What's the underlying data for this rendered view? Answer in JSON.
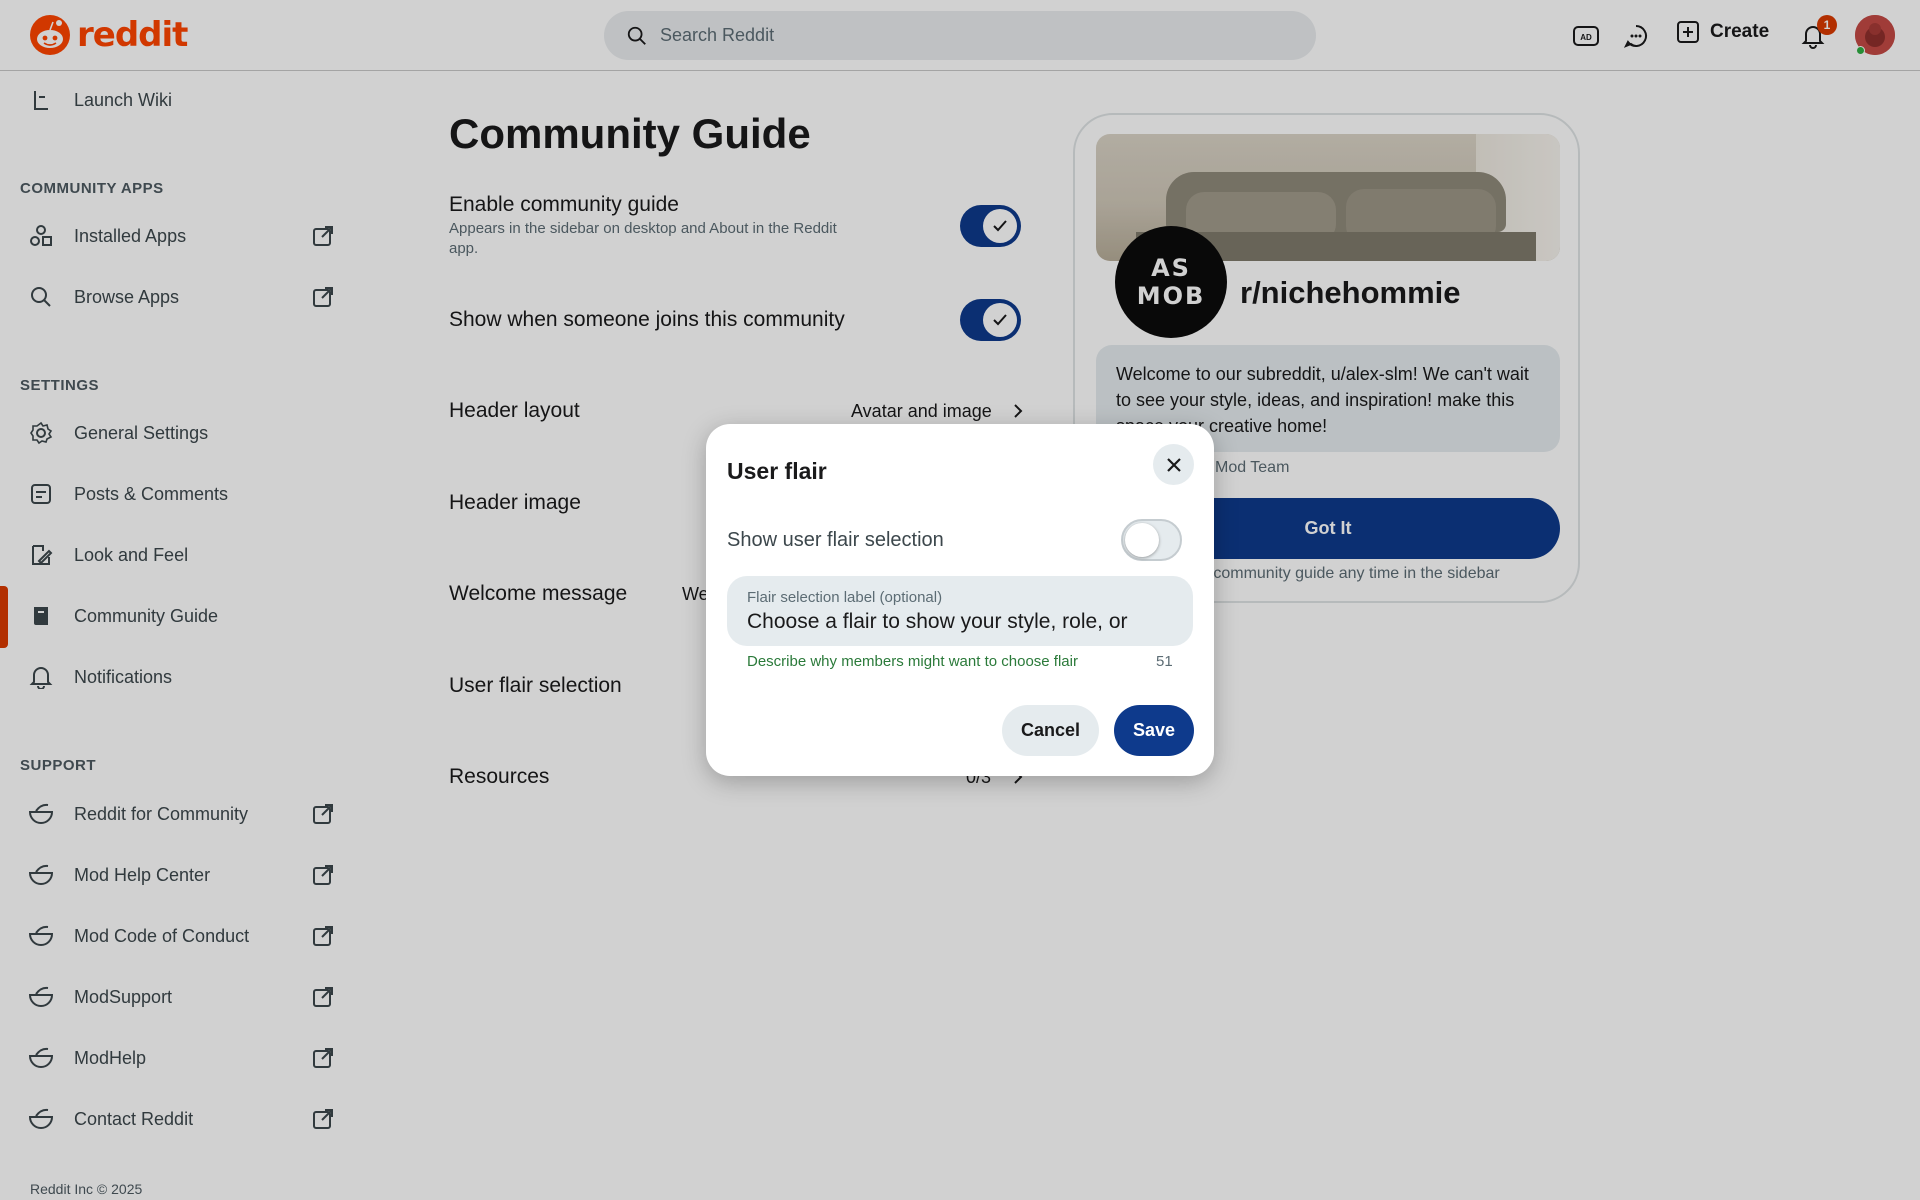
{
  "header": {
    "logo_text": "reddit",
    "search_placeholder": "Search Reddit",
    "create_label": "Create",
    "notification_count": "1",
    "icons": [
      "ad-icon",
      "chat-icon",
      "create-icon",
      "bell-icon"
    ]
  },
  "sidebar": {
    "launch_wiki": "Launch Wiki",
    "apps_heading": "COMMUNITY APPS",
    "apps": [
      {
        "label": "Installed Apps",
        "icon": "apps-icon",
        "external": true
      },
      {
        "label": "Browse Apps",
        "icon": "search-icon",
        "external": true
      }
    ],
    "settings_heading": "SETTINGS",
    "settings": [
      {
        "label": "General Settings",
        "icon": "gear-icon"
      },
      {
        "label": "Posts & Comments",
        "icon": "posts-icon"
      },
      {
        "label": "Look and Feel",
        "icon": "brush-icon"
      },
      {
        "label": "Community Guide",
        "icon": "book-icon",
        "active": true
      },
      {
        "label": "Notifications",
        "icon": "bell-icon"
      }
    ],
    "support_heading": "SUPPORT",
    "support": [
      {
        "label": "Reddit for Community"
      },
      {
        "label": "Mod Help Center"
      },
      {
        "label": "Mod Code of Conduct"
      },
      {
        "label": "ModSupport"
      },
      {
        "label": "ModHelp"
      },
      {
        "label": "Contact Reddit"
      }
    ],
    "footer": "Reddit Inc © 2025"
  },
  "main": {
    "title": "Community Guide",
    "enable_guide": {
      "label": "Enable community guide",
      "desc": "Appears in the sidebar on desktop and About in the Reddit app.",
      "enabled": true
    },
    "show_joins": {
      "label": "Show when someone joins this community",
      "enabled": true
    },
    "header_layout": {
      "label": "Header layout",
      "value": "Avatar and image"
    },
    "header_image": {
      "label": "Header image"
    },
    "welcome_message": {
      "label": "Welcome message",
      "value_partial": "We"
    },
    "user_flair": {
      "label": "User flair selection"
    },
    "resources": {
      "label": "Resources",
      "value": "0/3"
    }
  },
  "preview": {
    "community_name": "r/nichehommie",
    "avatar_text_top": "AS",
    "avatar_text_bottom": "MOB",
    "welcome_text": "Welcome to our subreddit, u/alex-slm! We can't wait to see your style, ideas, and inspiration! make this space your creative home!",
    "mod_team": "Mod Team",
    "got_it": "Got It",
    "footer_note": "e community guide any time in the sidebar"
  },
  "modal": {
    "title": "User flair",
    "toggle_label": "Show user flair selection",
    "toggle_on": false,
    "field_label": "Flair selection label (optional)",
    "field_value": "Choose a flair to show your style, role, or",
    "helper": "Describe why members might want to choose flair",
    "counter": "51",
    "cancel": "Cancel",
    "save": "Save"
  },
  "colors": {
    "brand": "#ff4500",
    "primary_button": "#0e3a8c",
    "active_indicator": "#d93a00",
    "helper_text": "#2b7a3a"
  }
}
